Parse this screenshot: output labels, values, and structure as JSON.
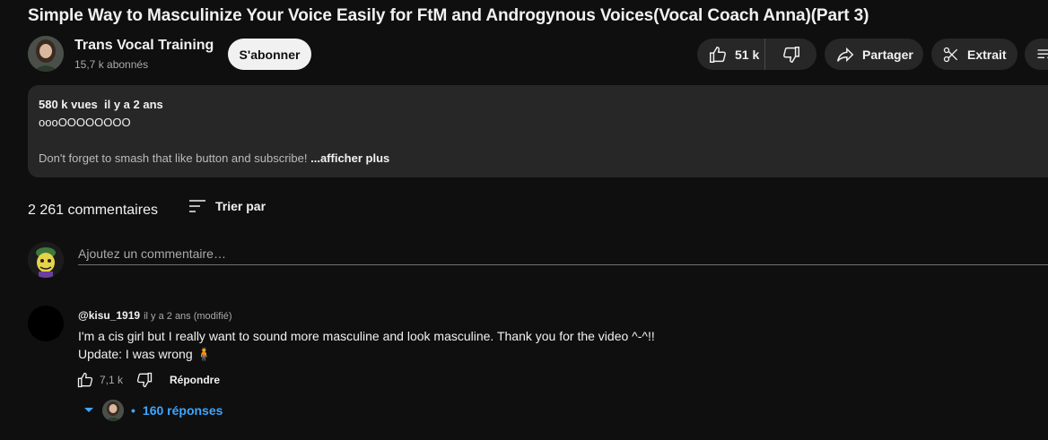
{
  "video": {
    "title": "Simple Way to Masculinize Your Voice Easily for FtM and Androgynous Voices(Vocal Coach Anna)(Part 3)"
  },
  "channel": {
    "name": "Trans Vocal Training",
    "subscribers": "15,7 k abonnés",
    "subscribe_label": "S'abonner"
  },
  "actions": {
    "likes": "51 k",
    "share_label": "Partager",
    "clip_label": "Extrait"
  },
  "description": {
    "stats": "580 k vues  il y a 2 ans",
    "line1": "oooOOOOOOOO",
    "line2": "Don't forget to smash that like button and subscribe! ",
    "more_label": "...afficher plus"
  },
  "comments": {
    "count_label": "2 261 commentaires",
    "sort_label": "Trier par",
    "add_placeholder": "Ajoutez un commentaire…",
    "items": [
      {
        "user": "@kisu_1919",
        "time": "il y a 2 ans (modifié)",
        "text_line1": "I'm a cis girl but I really want to sound more masculine and look masculine. Thank you for the video ^-^!!",
        "text_line2": "Update: I was wrong 🧍",
        "likes": "7,1 k",
        "reply_label": "Répondre",
        "replies_label": "160 réponses"
      }
    ]
  },
  "colors": {
    "background": "#0f0f0f",
    "surface": "#272727",
    "link": "#3ea6ff"
  }
}
